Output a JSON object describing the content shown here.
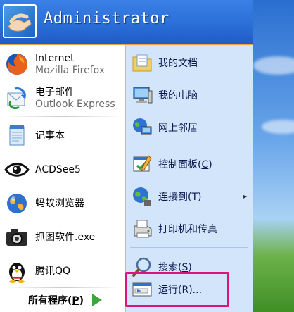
{
  "user": {
    "name": "Administrator"
  },
  "pinned": [
    {
      "title": "Internet",
      "subtitle": "Mozilla Firefox",
      "icon": "firefox-icon"
    },
    {
      "title": "电子邮件",
      "subtitle": "Outlook Express",
      "icon": "outlook-express-icon"
    }
  ],
  "recent": [
    {
      "title": "记事本",
      "icon": "notepad-icon"
    },
    {
      "title": "ACDSee5",
      "icon": "acdsee-eye-icon"
    },
    {
      "title": "蚂蚁浏览器",
      "icon": "globe-icon"
    },
    {
      "title": "抓图软件.exe",
      "icon": "camera-icon"
    },
    {
      "title": "腾讯QQ",
      "icon": "qq-penguin-icon"
    }
  ],
  "all_programs": {
    "label_pre": "所有程序(",
    "key": "P",
    "label_post": ")"
  },
  "places": [
    {
      "label": "我的文档",
      "icon": "my-documents-icon"
    },
    {
      "label": "我的电脑",
      "icon": "my-computer-icon"
    },
    {
      "label": "网上邻居",
      "icon": "network-icon"
    },
    {
      "label_pre": "控制面板(",
      "key": "C",
      "label_post": ")",
      "icon": "control-panel-icon"
    },
    {
      "label_pre": "连接到(",
      "key": "T",
      "label_post": ")",
      "icon": "connect-to-icon",
      "submenu": true
    },
    {
      "label": "打印机和传真",
      "icon": "printer-icon"
    },
    {
      "label_pre": "搜索(",
      "key": "S",
      "label_post": ")",
      "icon": "search-icon"
    },
    {
      "label_pre": "运行(",
      "key": "R",
      "label_post": ")...",
      "icon": "run-icon"
    }
  ],
  "submenu_arrow": "▸",
  "colors": {
    "header": "#2b6fd8",
    "right_pane": "#d3e5fa",
    "highlight": "#e0137a",
    "separator_orange": "#f1a23a"
  }
}
